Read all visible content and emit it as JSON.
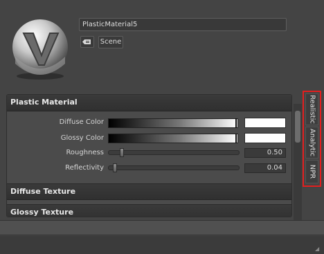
{
  "material": {
    "name": "PlasticMaterial5",
    "scene_label": "Scene"
  },
  "sections": {
    "plastic": {
      "title": "Plastic Material",
      "diffuse_color_label": "Diffuse Color",
      "glossy_color_label": "Glossy Color",
      "roughness_label": "Roughness",
      "roughness_value": "0.50",
      "reflectivity_label": "Reflectivity",
      "reflectivity_value": "0.04"
    },
    "diffuse_texture": {
      "title": "Diffuse Texture"
    },
    "glossy_texture": {
      "title": "Glossy Texture"
    }
  },
  "tabs": [
    {
      "label": "Realistic"
    },
    {
      "label": "Analytic"
    },
    {
      "label": "NPR"
    }
  ],
  "colors": {
    "highlight_outline": "#e41e1e",
    "swatch_diffuse": "#ffffff",
    "swatch_glossy": "#ffffff"
  }
}
